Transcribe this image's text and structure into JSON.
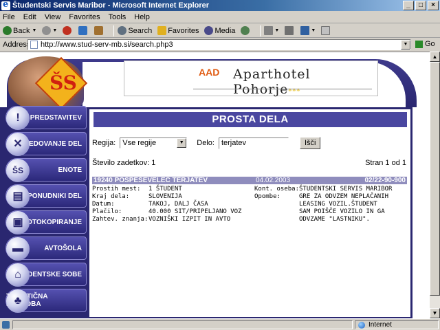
{
  "window": {
    "title": "Študentski Servis Maribor - Microsoft Internet Explorer"
  },
  "menu": [
    "File",
    "Edit",
    "View",
    "Favorites",
    "Tools",
    "Help"
  ],
  "toolbar": {
    "back": "Back",
    "search": "Search",
    "favorites": "Favorites",
    "media": "Media"
  },
  "address": {
    "label": "Address",
    "url": "http://www.stud-serv-mb.si/search.php3",
    "go": "Go"
  },
  "status": {
    "zone": "Internet"
  },
  "header": {
    "hotel_name": "Aparthotel Pohorje",
    "stars": "***",
    "logo_mark": "AAD"
  },
  "brand_logo": "ŠS",
  "nav": [
    {
      "label": "PREDSTAVITEV",
      "icon": "!"
    },
    {
      "label": "POSREDOVANJE DEL",
      "icon": "✕"
    },
    {
      "label": "ENOTE",
      "icon": "ŠS"
    },
    {
      "label": "PONUDNIKI DEL",
      "icon": "▤"
    },
    {
      "label": "FOTOKOPIRANJE",
      "icon": "▣"
    },
    {
      "label": "AVTOŠOLA",
      "icon": "▬"
    },
    {
      "label": "ŠTUDENTSKE SOBE",
      "icon": "⌂"
    },
    {
      "label": "TURISTIČNA PONUDBA",
      "icon": "♣"
    }
  ],
  "panel": {
    "title": "PROSTA DELA",
    "region_label": "Regija:",
    "region_value": "Vse regije",
    "job_label": "Delo:",
    "job_value": "terjatev",
    "search_button": "Išči",
    "count_label": "Število zadetkov: 1",
    "pages_label": "Stran 1 od 1"
  },
  "result": {
    "heading": "19240 POSPEŠEVELEC TERJATEV",
    "date": "04.02.2003",
    "phone": "02/22-90-900",
    "left": [
      {
        "label": "Prostih mest:",
        "value": "1 ŠTUDENT"
      },
      {
        "label": "Kraj dela:",
        "value": "SLOVENIJA"
      },
      {
        "label": "Datum:",
        "value": "TAKOJ, DALJ ČASA"
      },
      {
        "label": "Plačilo:",
        "value": "40.000 SIT/PRIPELJANO VOZ"
      },
      {
        "label": "Zahtev. znanja:",
        "value": "VOZNIŠKI IZPIT IN AVTO"
      }
    ],
    "contact_label": "Kont. oseba:",
    "contact_value": "ŠTUDENTSKI SERVIS MARIBOR",
    "notes_label": "Opombe:",
    "notes_lines": [
      "GRE ZA ODVZEM NEPLAČANIH",
      "LEASING VOZIL.ŠTUDENT",
      "SAM POIŠČE VOZILO IN GA",
      "ODVZAME \"LASTNIKU\"."
    ]
  }
}
